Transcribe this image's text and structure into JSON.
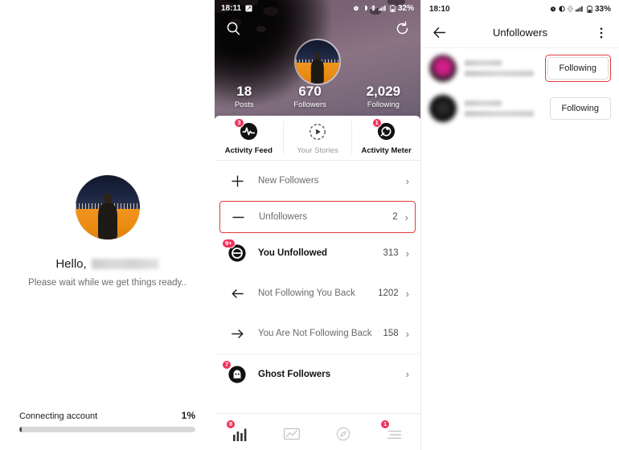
{
  "left": {
    "greeting": "Hello,",
    "username_masked": "",
    "wait_text": "Please wait while we get things ready..",
    "progress": {
      "label": "Connecting account",
      "percent_text": "1%",
      "percent": 1
    },
    "avatar_icon": "user-avatar"
  },
  "middle": {
    "statusbar": {
      "time": "18:11",
      "battery_text": "32%",
      "icons": [
        "screenshot-icon",
        "alarm-icon",
        "dnd-icon",
        "vibrate-icon",
        "signal-icon",
        "battery-icon"
      ]
    },
    "hero": {
      "search_icon": "search-icon",
      "refresh_icon": "refresh-icon",
      "avatar_icon": "profile-avatar",
      "stats": [
        {
          "value": "18",
          "label": "Posts"
        },
        {
          "value": "670",
          "label": "Followers"
        },
        {
          "value": "2,029",
          "label": "Following"
        }
      ]
    },
    "tabs": [
      {
        "label": "Activity Feed",
        "icon": "pulse-icon",
        "badge": "3",
        "active": true
      },
      {
        "label": "Your Stories",
        "icon": "story-play-icon",
        "badge": "",
        "active": false
      },
      {
        "label": "Activity Meter",
        "icon": "meter-icon",
        "badge": "1",
        "active": false
      }
    ],
    "rows": [
      {
        "label": "New Followers",
        "icon": "plus-icon",
        "count": "",
        "badge": "",
        "bold": false,
        "highlight": false
      },
      {
        "label": "Unfollowers",
        "icon": "minus-icon",
        "count": "2",
        "badge": "",
        "bold": false,
        "highlight": true
      },
      {
        "label": "You Unfollowed",
        "icon": "unfollow-icon",
        "count": "313",
        "badge": "9+",
        "bold": true,
        "highlight": false
      },
      {
        "label": "Not Following You Back",
        "icon": "arrow-left-icon",
        "count": "1202",
        "badge": "",
        "bold": false,
        "highlight": false
      },
      {
        "label": "You Are Not Following Back",
        "icon": "arrow-right-icon",
        "count": "158",
        "badge": "",
        "bold": false,
        "highlight": false
      },
      {
        "label": "Ghost Followers",
        "icon": "ghost-icon",
        "count": "",
        "badge": "7",
        "bold": true,
        "highlight": false
      }
    ],
    "bottom_nav": [
      {
        "icon": "bar-chart-icon",
        "badge": "8",
        "active": true
      },
      {
        "icon": "line-chart-icon",
        "badge": "",
        "active": false
      },
      {
        "icon": "compass-icon",
        "badge": "",
        "active": false
      },
      {
        "icon": "menu-lines-icon",
        "badge": "1",
        "active": false
      }
    ]
  },
  "right": {
    "statusbar": {
      "time": "18:10",
      "battery_text": "33%"
    },
    "appbar": {
      "title": "Unfollowers",
      "back_icon": "back-arrow-icon",
      "more_icon": "more-vertical-icon"
    },
    "users": [
      {
        "avatar_icon": "user-avatar-blurred",
        "name_masked": "",
        "handle_masked": "",
        "button_label": "Following",
        "highlight": true
      },
      {
        "avatar_icon": "user-avatar-blurred",
        "name_masked": "",
        "handle_masked": "",
        "button_label": "Following",
        "highlight": false
      }
    ]
  },
  "colors": {
    "accent_red": "#f0325b",
    "highlight_border": "#e23b3b",
    "badge_red": "#f0325b"
  }
}
